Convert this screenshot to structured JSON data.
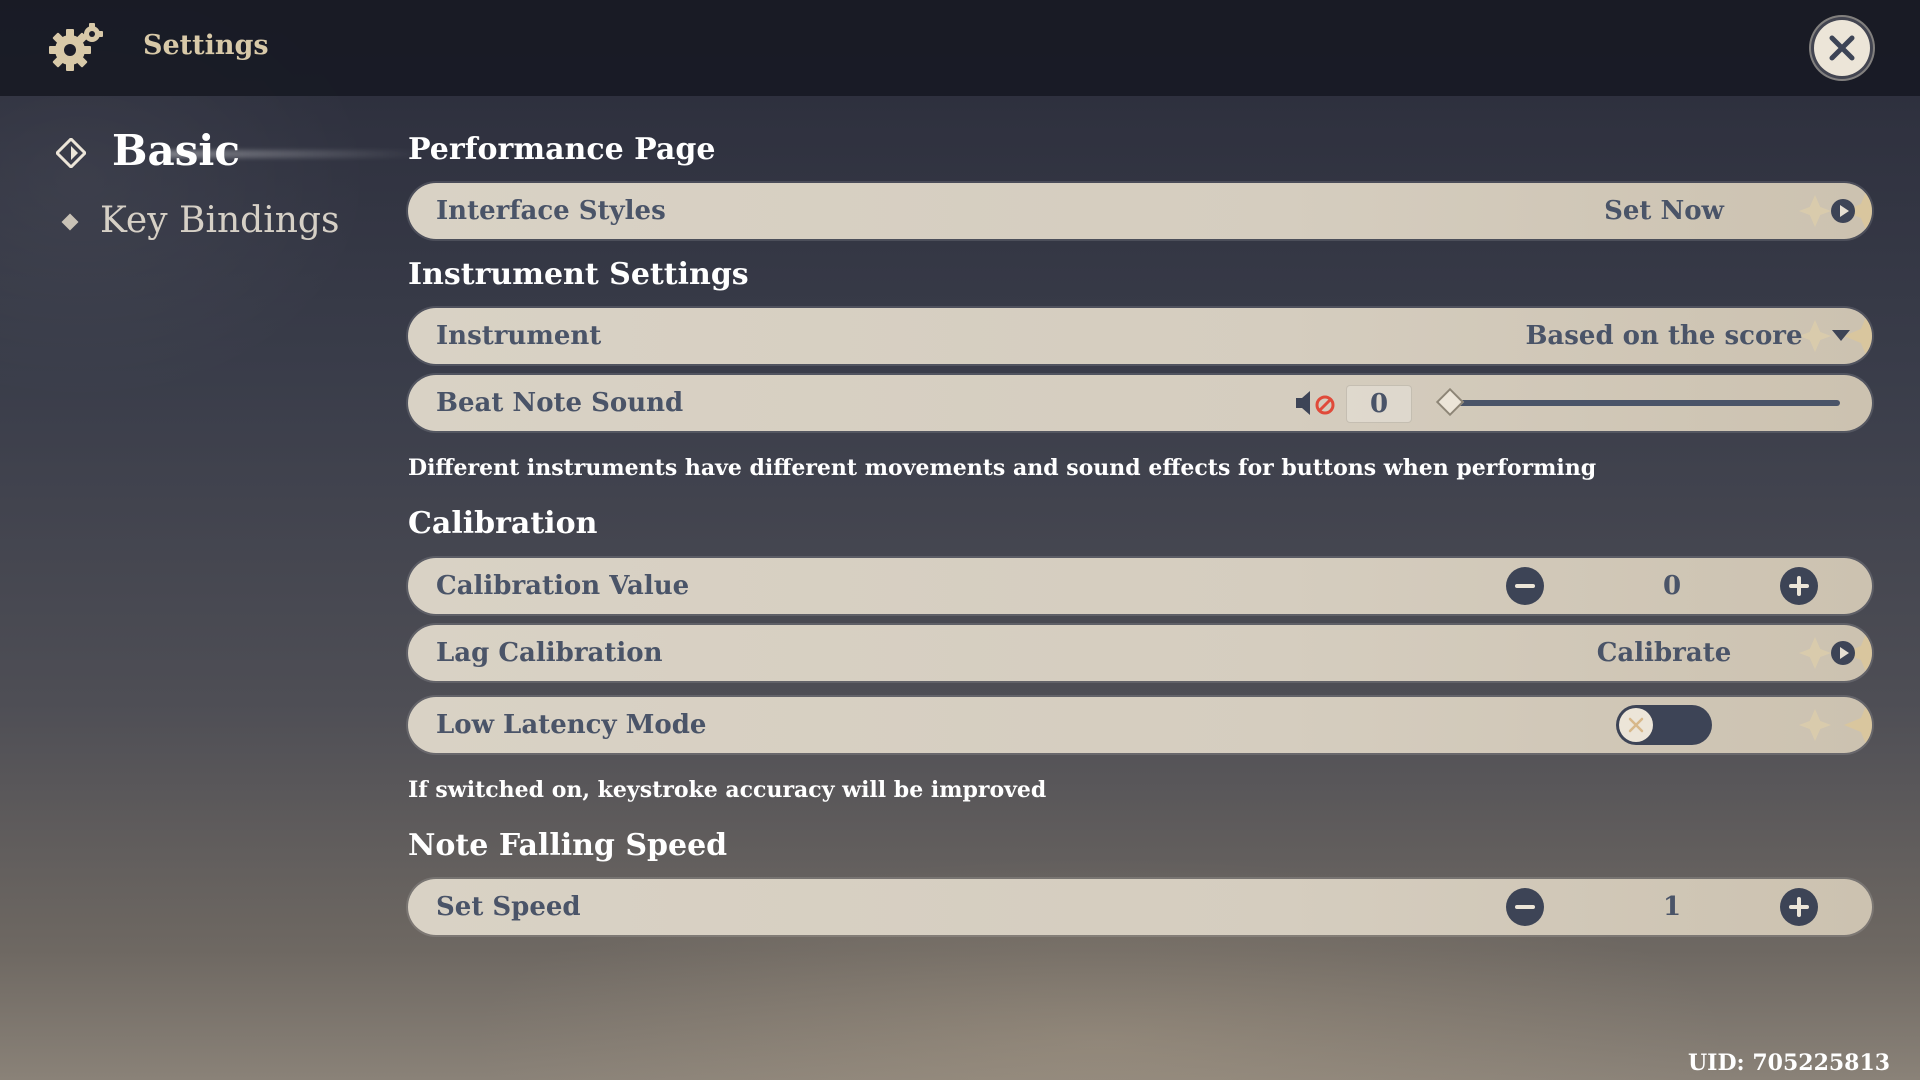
{
  "window": {
    "title": "Settings",
    "close_icon": "close-icon"
  },
  "sidebar": {
    "items": [
      {
        "label": "Basic",
        "active": true
      },
      {
        "label": "Key Bindings",
        "active": false
      }
    ]
  },
  "sections": {
    "performance": {
      "title": "Performance Page",
      "interface_styles": {
        "label": "Interface Styles",
        "value": "Set Now"
      }
    },
    "instrument": {
      "title": "Instrument Settings",
      "instrument": {
        "label": "Instrument",
        "value": "Based on the score"
      },
      "beat_note": {
        "label": "Beat Note Sound",
        "value": "0",
        "level": 0,
        "muted": true
      },
      "description": "Different instruments have different movements and sound effects for buttons when performing"
    },
    "calibration": {
      "title": "Calibration",
      "calibration_value": {
        "label": "Calibration Value",
        "value": "0"
      },
      "lag": {
        "label": "Lag Calibration",
        "value": "Calibrate"
      },
      "low_latency": {
        "label": "Low Latency Mode",
        "enabled": false
      },
      "description": "If switched on, keystroke accuracy will be improved"
    },
    "note_speed": {
      "title": "Note Falling Speed",
      "set_speed": {
        "label": "Set Speed",
        "value": "1"
      }
    }
  },
  "footer": {
    "uid": "UID: 705225813"
  },
  "colors": {
    "row_bg": "#d9d2c5",
    "row_text": "#4a5468",
    "accent_dark": "#3d4456",
    "title_gold": "#d8c9a8",
    "mute_red": "#e04a3a"
  }
}
